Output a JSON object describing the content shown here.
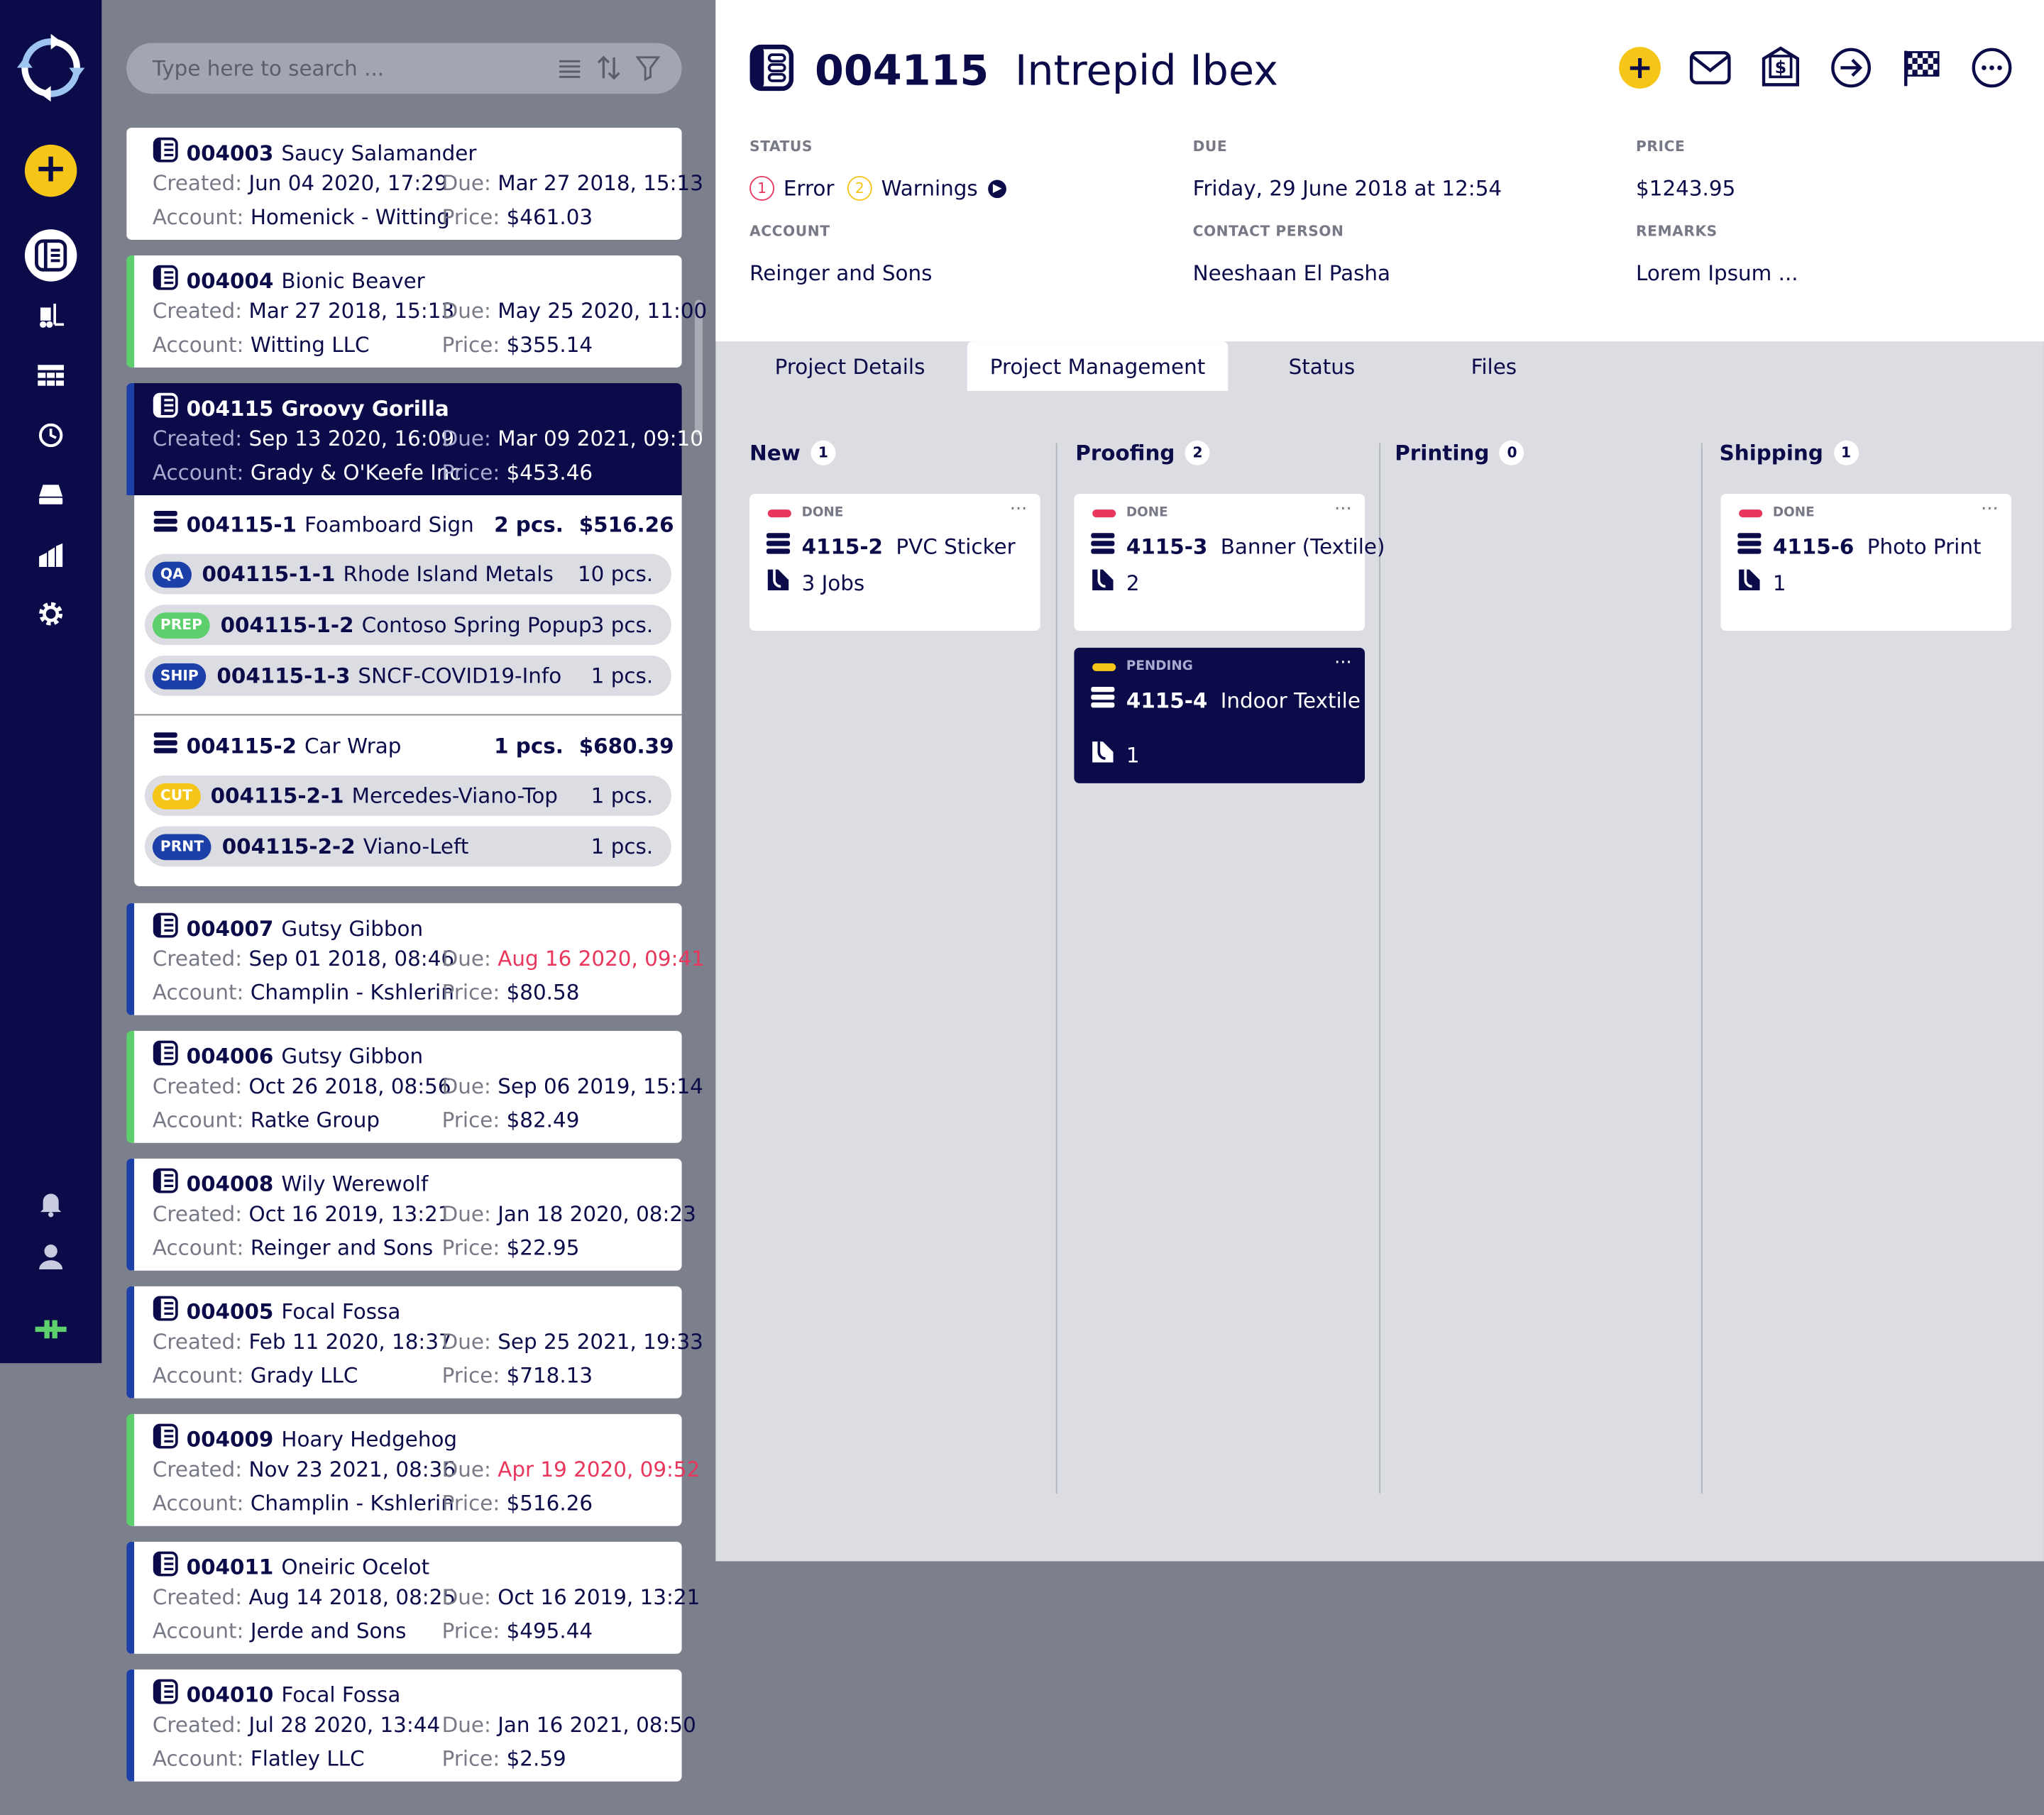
{
  "search": {
    "placeholder": "Type here to search ..."
  },
  "list": {
    "labels": {
      "created": "Created:",
      "due": "Due:",
      "account": "Account:",
      "price": "Price:"
    },
    "cards": [
      {
        "number": "004003",
        "name": "Saucy Salamander",
        "created": "Jun 04 2020, 17:29",
        "due": "Mar 27 2018, 15:13",
        "account": "Homenick - Witting",
        "price": "$461.03"
      },
      {
        "number": "004004",
        "name": "Bionic Beaver",
        "created": "Mar 27 2018, 15:13",
        "due": "May 25 2020, 11:00",
        "account": "Witting LLC",
        "price": "$355.14"
      },
      {
        "number": "004115",
        "name": "Groovy Gorilla",
        "created": "Sep 13 2020, 16:09",
        "due": "Mar 09 2021, 09:10",
        "account": "Grady & O'Keefe Inc",
        "price": "$453.46"
      },
      {
        "number": "004007",
        "name": "Gutsy Gibbon",
        "created": "Sep 01 2018, 08:46",
        "due": "Aug 16 2020, 09:41",
        "account": "Champlin - Kshlerin",
        "price": "$80.58"
      },
      {
        "number": "004006",
        "name": "Gutsy Gibbon",
        "created": "Oct 26 2018, 08:56",
        "due": "Sep 06 2019, 15:14",
        "account": "Ratke Group",
        "price": "$82.49"
      },
      {
        "number": "004008",
        "name": "Wily Werewolf",
        "created": "Oct 16 2019, 13:21",
        "due": "Jan 18 2020, 08:23",
        "account": "Reinger and Sons",
        "price": "$22.95"
      },
      {
        "number": "004005",
        "name": "Focal Fossa",
        "created": "Feb 11 2020, 18:37",
        "due": "Sep 25 2021, 19:33",
        "account": "Grady LLC",
        "price": "$718.13"
      },
      {
        "number": "004009",
        "name": "Hoary Hedgehog",
        "created": "Nov 23 2021, 08:36",
        "due": "Apr 19 2020, 09:52",
        "account": "Champlin - Kshlerin",
        "price": "$516.26"
      },
      {
        "number": "004011",
        "name": "Oneiric Ocelot",
        "created": "Aug 14 2018, 08:25",
        "due": "Oct 16 2019, 13:21",
        "account": "Jerde and Sons",
        "price": "$495.44"
      },
      {
        "number": "004010",
        "name": "Focal Fossa",
        "created": "Jul 28 2020, 13:44",
        "due": "Jan 16 2021, 08:50",
        "account": "Flatley LLC",
        "price": "$2.59"
      }
    ],
    "expanded": {
      "items": [
        {
          "id": "004115-1",
          "name": "Foamboard Sign",
          "pcs": "2 pcs.",
          "price": "$516.26",
          "subs": [
            {
              "badge": "QA",
              "id": "004115-1-1",
              "name": "Rhode Island Metals",
              "pcs": "10 pcs."
            },
            {
              "badge": "PREP",
              "id": "004115-1-2",
              "name": "Contoso Spring Popup",
              "pcs": "3 pcs."
            },
            {
              "badge": "SHIP",
              "id": "004115-1-3",
              "name": "SNCF-COVID19-Info",
              "pcs": "1 pcs."
            }
          ]
        },
        {
          "id": "004115-2",
          "name": "Car Wrap",
          "pcs": "1 pcs.",
          "price": "$680.39",
          "subs": [
            {
              "badge": "CUT",
              "id": "004115-2-1",
              "name": "Mercedes-Viano-Top",
              "pcs": "1 pcs."
            },
            {
              "badge": "PRNT",
              "id": "004115-2-2",
              "name": "Viano-Left",
              "pcs": "1 pcs."
            }
          ]
        }
      ]
    }
  },
  "detail": {
    "number": "004115",
    "name": "Intrepid Ibex",
    "status_label": "STATUS",
    "error_count": "1",
    "error_text": "Error",
    "warning_count": "2",
    "warning_text": "Warnings",
    "due_label": "DUE",
    "due_value": "Friday, 29 June 2018 at 12:54",
    "price_label": "PRICE",
    "price_value": "$1243.95",
    "account_label": "ACCOUNT",
    "account_value": "Reinger and Sons",
    "contact_label": "CONTACT PERSON",
    "contact_value": "Neeshaan El Pasha",
    "remarks_label": "REMARKS",
    "remarks_value": "Lorem Ipsum ...",
    "tabs": [
      "Project Details",
      "Project Management",
      "Status",
      "Files"
    ]
  },
  "board": {
    "columns": [
      {
        "title": "New",
        "count": "1"
      },
      {
        "title": "Proofing",
        "count": "2"
      },
      {
        "title": "Printing",
        "count": "0"
      },
      {
        "title": "Shipping",
        "count": "1"
      }
    ],
    "cards": [
      {
        "status": "DONE",
        "id": "4115-2",
        "name": "PVC Sticker",
        "jobs": "3 Jobs"
      },
      {
        "status": "DONE",
        "id": "4115-3",
        "name": "Banner (Textile)",
        "jobs": "2"
      },
      {
        "status": "PENDING",
        "id": "4115-4",
        "name": "Indoor Textile",
        "jobs": "1"
      },
      {
        "status": "DONE",
        "id": "4115-6",
        "name": "Photo Print",
        "jobs": "1"
      }
    ],
    "more": "···"
  },
  "colors": {
    "navy": "#0b0b4a",
    "accent_yellow": "#f5c518",
    "green": "#5dd06d",
    "blue": "#1d3fa8",
    "red": "#e8365d"
  },
  "icons": [
    "logo-icon",
    "add-icon",
    "projects-icon",
    "forklift-icon",
    "table-icon",
    "history-icon",
    "printer-icon",
    "analytics-icon",
    "settings-icon",
    "bell-icon",
    "user-icon",
    "plug-icon",
    "mail-icon",
    "invoice-icon",
    "forward-icon",
    "finish-flag-icon",
    "more-icon",
    "list-icon",
    "sort-icon",
    "filter-icon",
    "job-stack-icon",
    "file-icon"
  ]
}
